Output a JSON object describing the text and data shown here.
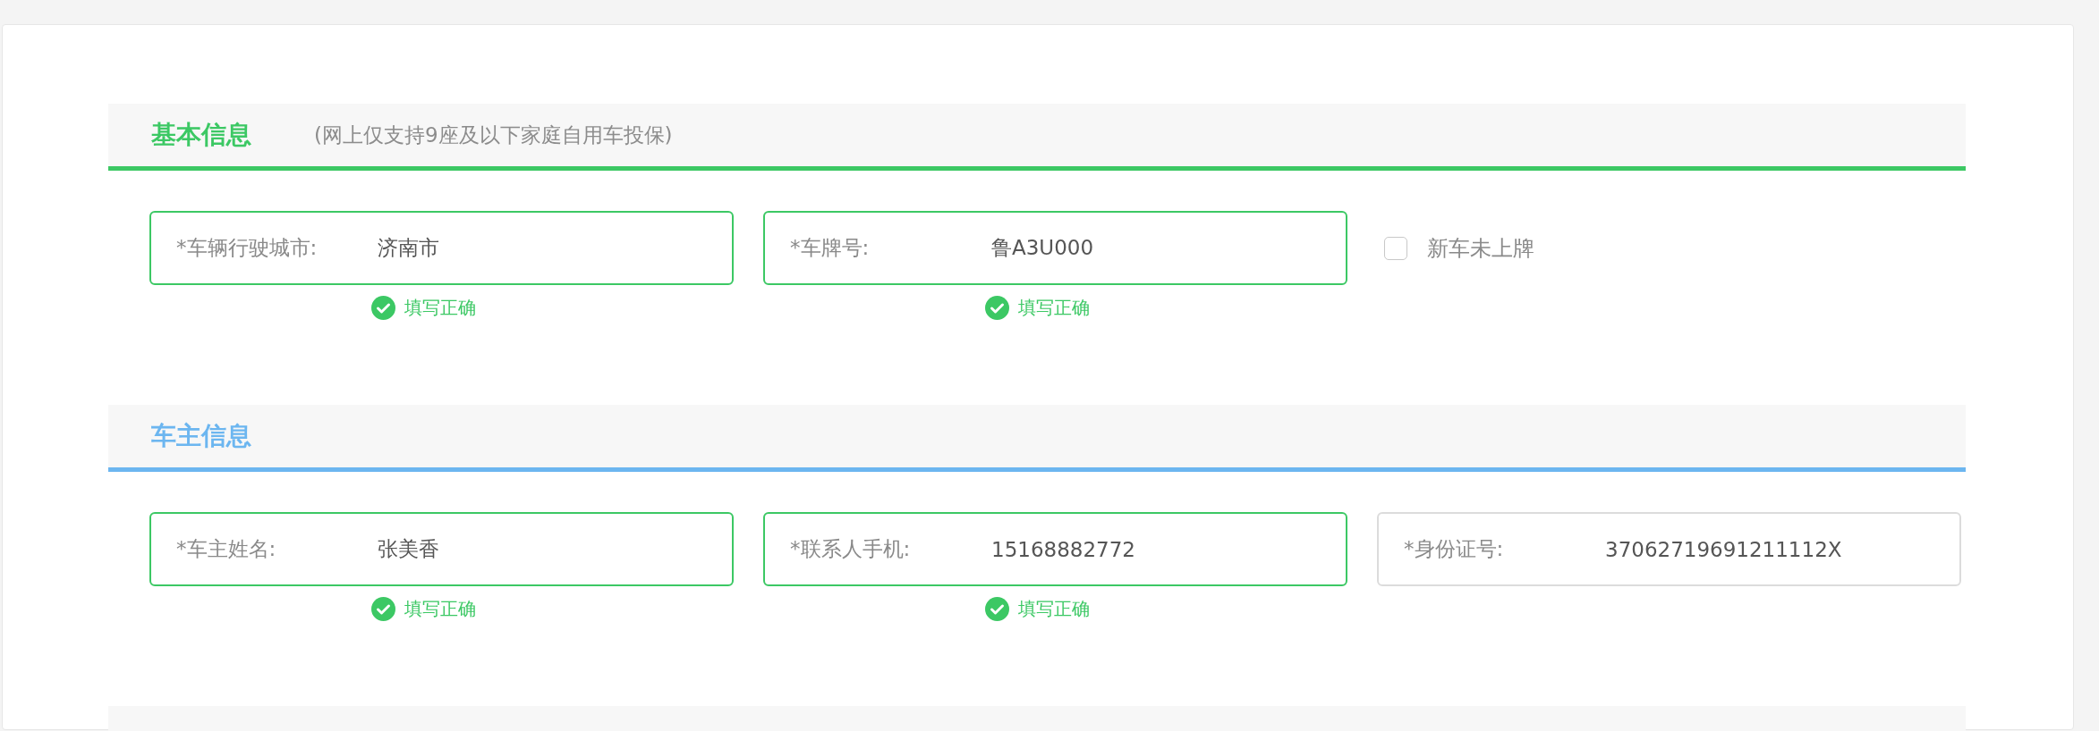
{
  "sections": [
    {
      "title": "基本信息",
      "note": "(网上仅支持9座及以下家庭自用车投保)",
      "color": "#3cc864",
      "fields": [
        {
          "kind": "field",
          "label": "*车辆行驶城市:",
          "value": "济南市",
          "valid": true,
          "hint": "填写正确"
        },
        {
          "kind": "field",
          "label": "*车牌号:",
          "value": "鲁A3U000",
          "valid": true,
          "hint": "填写正确"
        },
        {
          "kind": "checkbox",
          "label": "新车未上牌",
          "checked": false
        }
      ]
    },
    {
      "title": "车主信息",
      "color": "#6cb6f0",
      "fields": [
        {
          "kind": "field",
          "label": "*车主姓名:",
          "value": "张美香",
          "valid": true,
          "hint": "填写正确"
        },
        {
          "kind": "field",
          "label": "*联系人手机:",
          "value": "15168882772",
          "valid": true,
          "hint": "填写正确"
        },
        {
          "kind": "field",
          "label": "*身份证号:",
          "value": "37062719691211112X",
          "valid": false
        }
      ]
    }
  ]
}
